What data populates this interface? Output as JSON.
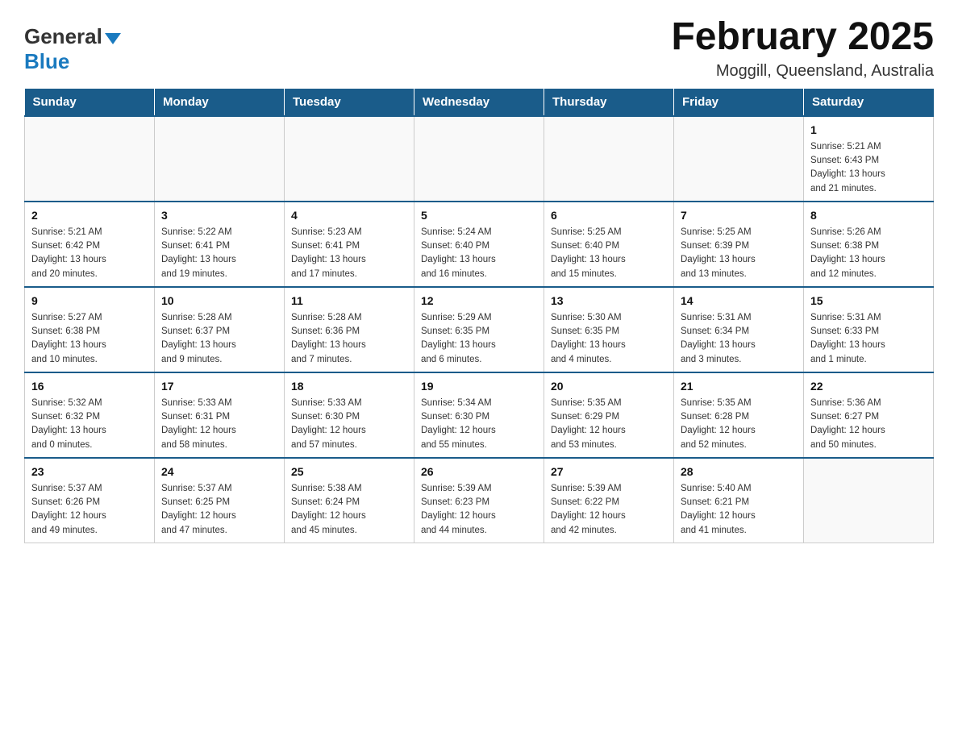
{
  "logo": {
    "general": "General",
    "blue": "Blue"
  },
  "title": "February 2025",
  "subtitle": "Moggill, Queensland, Australia",
  "days_of_week": [
    "Sunday",
    "Monday",
    "Tuesday",
    "Wednesday",
    "Thursday",
    "Friday",
    "Saturday"
  ],
  "weeks": [
    [
      {
        "day": "",
        "info": ""
      },
      {
        "day": "",
        "info": ""
      },
      {
        "day": "",
        "info": ""
      },
      {
        "day": "",
        "info": ""
      },
      {
        "day": "",
        "info": ""
      },
      {
        "day": "",
        "info": ""
      },
      {
        "day": "1",
        "info": "Sunrise: 5:21 AM\nSunset: 6:43 PM\nDaylight: 13 hours\nand 21 minutes."
      }
    ],
    [
      {
        "day": "2",
        "info": "Sunrise: 5:21 AM\nSunset: 6:42 PM\nDaylight: 13 hours\nand 20 minutes."
      },
      {
        "day": "3",
        "info": "Sunrise: 5:22 AM\nSunset: 6:41 PM\nDaylight: 13 hours\nand 19 minutes."
      },
      {
        "day": "4",
        "info": "Sunrise: 5:23 AM\nSunset: 6:41 PM\nDaylight: 13 hours\nand 17 minutes."
      },
      {
        "day": "5",
        "info": "Sunrise: 5:24 AM\nSunset: 6:40 PM\nDaylight: 13 hours\nand 16 minutes."
      },
      {
        "day": "6",
        "info": "Sunrise: 5:25 AM\nSunset: 6:40 PM\nDaylight: 13 hours\nand 15 minutes."
      },
      {
        "day": "7",
        "info": "Sunrise: 5:25 AM\nSunset: 6:39 PM\nDaylight: 13 hours\nand 13 minutes."
      },
      {
        "day": "8",
        "info": "Sunrise: 5:26 AM\nSunset: 6:38 PM\nDaylight: 13 hours\nand 12 minutes."
      }
    ],
    [
      {
        "day": "9",
        "info": "Sunrise: 5:27 AM\nSunset: 6:38 PM\nDaylight: 13 hours\nand 10 minutes."
      },
      {
        "day": "10",
        "info": "Sunrise: 5:28 AM\nSunset: 6:37 PM\nDaylight: 13 hours\nand 9 minutes."
      },
      {
        "day": "11",
        "info": "Sunrise: 5:28 AM\nSunset: 6:36 PM\nDaylight: 13 hours\nand 7 minutes."
      },
      {
        "day": "12",
        "info": "Sunrise: 5:29 AM\nSunset: 6:35 PM\nDaylight: 13 hours\nand 6 minutes."
      },
      {
        "day": "13",
        "info": "Sunrise: 5:30 AM\nSunset: 6:35 PM\nDaylight: 13 hours\nand 4 minutes."
      },
      {
        "day": "14",
        "info": "Sunrise: 5:31 AM\nSunset: 6:34 PM\nDaylight: 13 hours\nand 3 minutes."
      },
      {
        "day": "15",
        "info": "Sunrise: 5:31 AM\nSunset: 6:33 PM\nDaylight: 13 hours\nand 1 minute."
      }
    ],
    [
      {
        "day": "16",
        "info": "Sunrise: 5:32 AM\nSunset: 6:32 PM\nDaylight: 13 hours\nand 0 minutes."
      },
      {
        "day": "17",
        "info": "Sunrise: 5:33 AM\nSunset: 6:31 PM\nDaylight: 12 hours\nand 58 minutes."
      },
      {
        "day": "18",
        "info": "Sunrise: 5:33 AM\nSunset: 6:30 PM\nDaylight: 12 hours\nand 57 minutes."
      },
      {
        "day": "19",
        "info": "Sunrise: 5:34 AM\nSunset: 6:30 PM\nDaylight: 12 hours\nand 55 minutes."
      },
      {
        "day": "20",
        "info": "Sunrise: 5:35 AM\nSunset: 6:29 PM\nDaylight: 12 hours\nand 53 minutes."
      },
      {
        "day": "21",
        "info": "Sunrise: 5:35 AM\nSunset: 6:28 PM\nDaylight: 12 hours\nand 52 minutes."
      },
      {
        "day": "22",
        "info": "Sunrise: 5:36 AM\nSunset: 6:27 PM\nDaylight: 12 hours\nand 50 minutes."
      }
    ],
    [
      {
        "day": "23",
        "info": "Sunrise: 5:37 AM\nSunset: 6:26 PM\nDaylight: 12 hours\nand 49 minutes."
      },
      {
        "day": "24",
        "info": "Sunrise: 5:37 AM\nSunset: 6:25 PM\nDaylight: 12 hours\nand 47 minutes."
      },
      {
        "day": "25",
        "info": "Sunrise: 5:38 AM\nSunset: 6:24 PM\nDaylight: 12 hours\nand 45 minutes."
      },
      {
        "day": "26",
        "info": "Sunrise: 5:39 AM\nSunset: 6:23 PM\nDaylight: 12 hours\nand 44 minutes."
      },
      {
        "day": "27",
        "info": "Sunrise: 5:39 AM\nSunset: 6:22 PM\nDaylight: 12 hours\nand 42 minutes."
      },
      {
        "day": "28",
        "info": "Sunrise: 5:40 AM\nSunset: 6:21 PM\nDaylight: 12 hours\nand 41 minutes."
      },
      {
        "day": "",
        "info": ""
      }
    ]
  ]
}
